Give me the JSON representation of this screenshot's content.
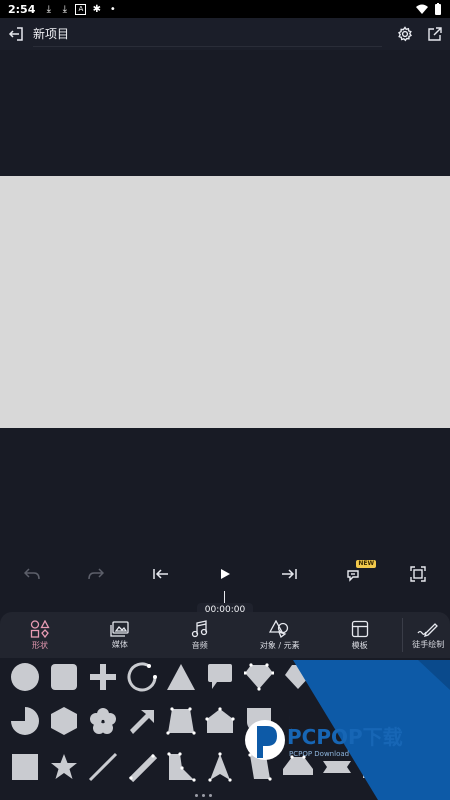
{
  "status_bar": {
    "time": "2:54",
    "icons": [
      "download-icon",
      "download-icon",
      "a-box-icon",
      "bug-icon",
      "dot-icon"
    ],
    "right_icons": [
      "wifi-icon",
      "battery-icon"
    ]
  },
  "header": {
    "title": "新项目"
  },
  "transport": {
    "buttons": [
      "undo",
      "redo",
      "jump-start",
      "play",
      "jump-end",
      "add-keyframe",
      "fullscreen"
    ],
    "new_badge": "NEW"
  },
  "timeline": {
    "time": "00:00:00"
  },
  "tabs": [
    {
      "label": "形状",
      "icon": "shapes-icon",
      "active": true
    },
    {
      "label": "媒体",
      "icon": "media-icon",
      "active": false
    },
    {
      "label": "音频",
      "icon": "music-note-icon",
      "active": false
    },
    {
      "label": "对象 / 元素",
      "icon": "objects-icon",
      "active": false
    },
    {
      "label": "模板",
      "icon": "template-icon",
      "active": false
    },
    {
      "label": "徒手绘制",
      "icon": "freehand-pen-icon",
      "active": false
    }
  ],
  "shapes": [
    "circle",
    "rounded-square",
    "cross",
    "arc",
    "triangle",
    "speech-bubble",
    "pentagon-down",
    "polygon",
    "pie",
    "hexagon",
    "flower",
    "arrow",
    "trapezoid",
    "house-shape",
    "shield",
    "crescent",
    "square",
    "star",
    "line",
    "thick-line",
    "quad",
    "spike",
    "parallelogram",
    "wide-house",
    "ribbon",
    "wave"
  ],
  "watermark": {
    "text": "PCPOP下载",
    "subtext": "PCPOP Download"
  },
  "colors": {
    "background": "#181b25",
    "canvas": "#d8d8d8",
    "accent": "#e79bb3",
    "watermark_blue": "#0d5aa7"
  }
}
